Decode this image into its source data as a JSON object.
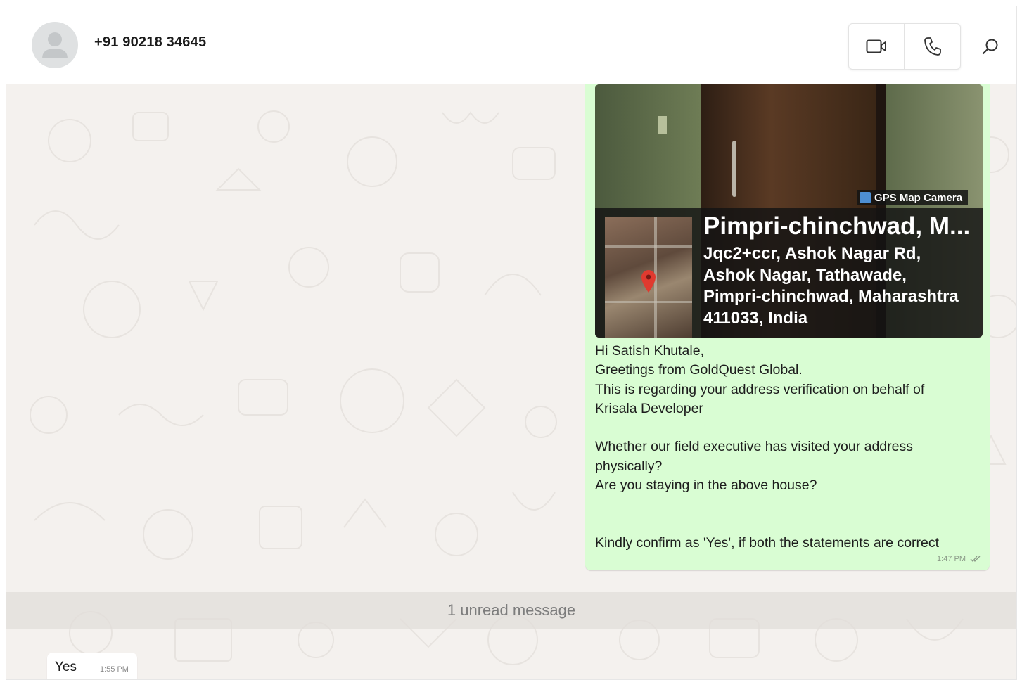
{
  "contact": {
    "name": "+91 90218 34645"
  },
  "header": {
    "video_icon": "video-camera-icon",
    "phone_icon": "phone-icon",
    "search_icon": "search-icon"
  },
  "message_out": {
    "photo": {
      "badge": "GPS Map Camera",
      "title": "Pimpri-chinchwad, M...",
      "address_lines": [
        "Jqc2+ccr, Ashok Nagar Rd,",
        "Ashok Nagar, Tathawade,",
        "Pimpri-chinchwad, Maharashtra",
        "411033, India"
      ]
    },
    "lines": [
      "Hi Satish Khutale,",
      "Greetings from GoldQuest Global.",
      "This is regarding your address verification on behalf of",
      "Krisala Developer",
      "",
      "Whether our field executive has visited your address",
      "physically?",
      "Are you staying in the above house?",
      "",
      "",
      "Kindly confirm as 'Yes', if both the statements are correct"
    ],
    "time": "1:47 PM",
    "status_icon": "double-check-icon"
  },
  "divider": {
    "unread": "1 unread message"
  },
  "message_in": {
    "text": "Yes",
    "time": "1:55 PM"
  },
  "colors": {
    "outgoing_bubble": "#d9fdd3",
    "incoming_bubble": "#ffffff",
    "chat_background": "#f4f1ee"
  }
}
